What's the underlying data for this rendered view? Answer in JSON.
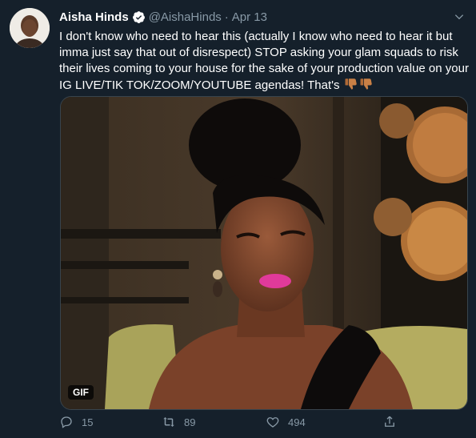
{
  "tweet": {
    "author": {
      "name": "Aisha Hinds",
      "handle": "@AishaHinds",
      "separator": "·",
      "date": "Apr 13"
    },
    "text": "I don't know who need to hear this (actually I know who need to hear it but imma just say that out of disrespect) STOP asking your glam squads to risk their lives coming to your house for the sake of your production value on your IG LIVE/TIK TOK/ZOOM/YOUTUBE agendas! That's",
    "emoji": [
      "thumbs-down",
      "thumbs-down"
    ],
    "media": {
      "badge": "GIF"
    },
    "actions": {
      "replies": "15",
      "retweets": "89",
      "likes": "494"
    }
  },
  "colors": {
    "background": "#15202b",
    "text": "#ffffff",
    "secondary": "#8899a6",
    "verified": "#ffffff",
    "border": "#38444d"
  },
  "icons": [
    "verified-badge-icon",
    "chevron-down-icon",
    "reply-icon",
    "retweet-icon",
    "like-icon",
    "share-icon",
    "thumbs-down-icon"
  ]
}
